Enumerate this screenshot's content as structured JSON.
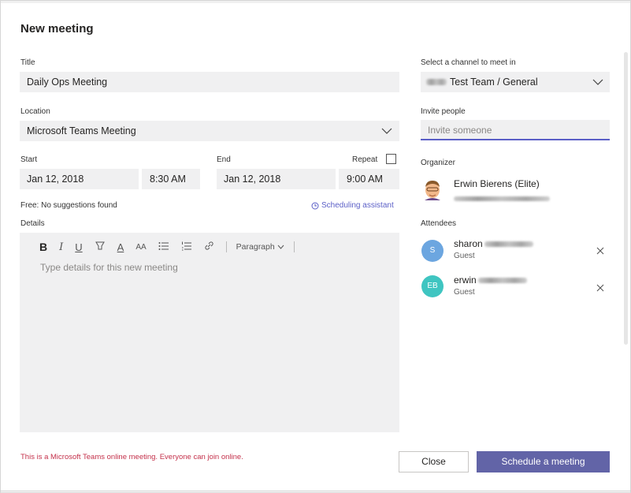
{
  "dialog": {
    "title": "New meeting"
  },
  "form": {
    "title_label": "Title",
    "title_value": "Daily Ops Meeting",
    "location_label": "Location",
    "location_value": "Microsoft Teams Meeting",
    "start_label": "Start",
    "start_date": "Jan 12, 2018",
    "start_time": "8:30 AM",
    "end_label": "End",
    "end_date": "Jan 12, 2018",
    "end_time": "9:00 AM",
    "repeat_label": "Repeat",
    "free_text": "Free: No suggestions found",
    "scheduling_assistant": "Scheduling assistant",
    "details_label": "Details",
    "details_placeholder": "Type details for this new meeting",
    "paragraph_label": "Paragraph"
  },
  "right": {
    "channel_label": "Select a channel to meet in",
    "channel_value": "Test Team / General",
    "invite_label": "Invite people",
    "invite_placeholder": "Invite someone",
    "organizer_label": "Organizer",
    "organizer_name": "Erwin Bierens (Elite)",
    "attendees_label": "Attendees",
    "attendees": [
      {
        "initials": "S",
        "name": "sharon",
        "role": "Guest",
        "color": "#6ca6e0"
      },
      {
        "initials": "EB",
        "name": "erwin",
        "role": "Guest",
        "color": "#3fc5c1"
      }
    ]
  },
  "footer": {
    "notice": "This is a Microsoft Teams online meeting. Everyone can join online.",
    "close_label": "Close",
    "schedule_label": "Schedule a meeting"
  },
  "colors": {
    "accent": "#6264a7",
    "link": "#5b5fc7",
    "notice": "#c4314b",
    "field_bg": "#f0f0f1"
  }
}
